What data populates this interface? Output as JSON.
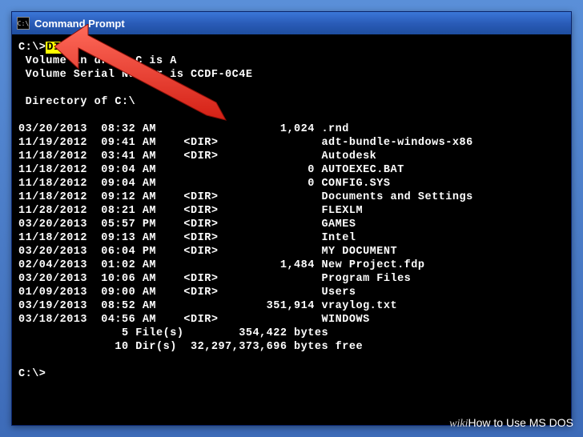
{
  "window": {
    "title": "Command Prompt",
    "icon_label": "C:\\"
  },
  "prompt": {
    "prefix": "C:\\>",
    "command": "DIR"
  },
  "volume": {
    "line1": " Volume in drive C is A",
    "line2": " Volume Serial Number is CCDF-0C4E"
  },
  "dir_header": " Directory of C:\\",
  "entries": [
    {
      "date": "03/20/2013",
      "time": "08:32 AM",
      "dir": "     ",
      "size": "        1,024",
      "name": ".rnd"
    },
    {
      "date": "11/19/2012",
      "time": "09:41 AM",
      "dir": "<DIR>",
      "size": "             ",
      "name": "adt-bundle-windows-x86"
    },
    {
      "date": "11/18/2012",
      "time": "03:41 AM",
      "dir": "<DIR>",
      "size": "             ",
      "name": "Autodesk"
    },
    {
      "date": "11/18/2012",
      "time": "09:04 AM",
      "dir": "     ",
      "size": "            0",
      "name": "AUTOEXEC.BAT"
    },
    {
      "date": "11/18/2012",
      "time": "09:04 AM",
      "dir": "     ",
      "size": "            0",
      "name": "CONFIG.SYS"
    },
    {
      "date": "11/18/2012",
      "time": "09:12 AM",
      "dir": "<DIR>",
      "size": "             ",
      "name": "Documents and Settings"
    },
    {
      "date": "11/28/2012",
      "time": "08:21 AM",
      "dir": "<DIR>",
      "size": "             ",
      "name": "FLEXLM"
    },
    {
      "date": "03/20/2013",
      "time": "05:57 PM",
      "dir": "<DIR>",
      "size": "             ",
      "name": "GAMES"
    },
    {
      "date": "11/18/2012",
      "time": "09:13 AM",
      "dir": "<DIR>",
      "size": "             ",
      "name": "Intel"
    },
    {
      "date": "03/20/2013",
      "time": "06:04 PM",
      "dir": "<DIR>",
      "size": "             ",
      "name": "MY DOCUMENT"
    },
    {
      "date": "02/04/2013",
      "time": "01:02 AM",
      "dir": "     ",
      "size": "        1,484",
      "name": "New Project.fdp"
    },
    {
      "date": "03/20/2013",
      "time": "10:06 AM",
      "dir": "<DIR>",
      "size": "             ",
      "name": "Program Files"
    },
    {
      "date": "01/09/2013",
      "time": "09:00 AM",
      "dir": "<DIR>",
      "size": "             ",
      "name": "Users"
    },
    {
      "date": "03/19/2013",
      "time": "08:52 AM",
      "dir": "     ",
      "size": "      351,914",
      "name": "vraylog.txt"
    },
    {
      "date": "03/18/2013",
      "time": "04:56 AM",
      "dir": "<DIR>",
      "size": "             ",
      "name": "WINDOWS"
    }
  ],
  "summary": {
    "files": "               5 File(s)        354,422 bytes",
    "dirs": "              10 Dir(s)  32,297,373,696 bytes free"
  },
  "end_prompt": "C:\\>",
  "watermark": {
    "wiki": "wiki",
    "rest": "How to Use MS DOS"
  }
}
